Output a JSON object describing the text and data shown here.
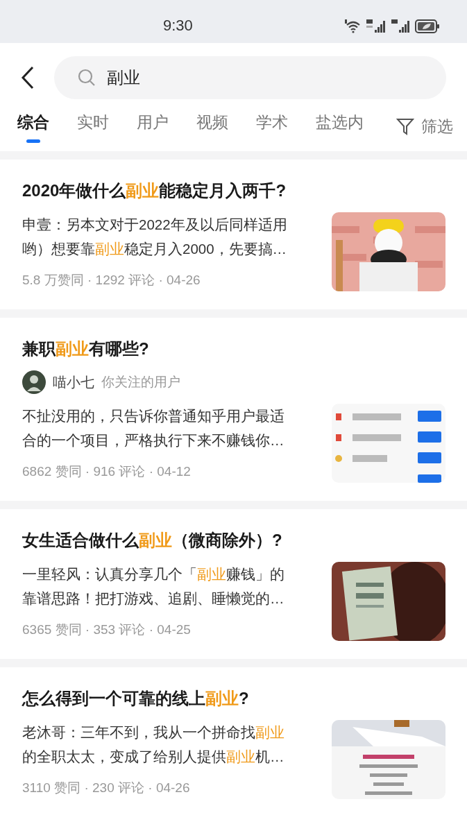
{
  "status_bar": {
    "time": "9:30"
  },
  "search": {
    "value": "副业"
  },
  "tabs": [
    {
      "label": "综合",
      "selected": true
    },
    {
      "label": "实时",
      "selected": false
    },
    {
      "label": "用户",
      "selected": false
    },
    {
      "label": "视频",
      "selected": false
    },
    {
      "label": "学术",
      "selected": false
    },
    {
      "label": "盐选内",
      "selected": false
    }
  ],
  "filter": {
    "label": "筛选"
  },
  "results": [
    {
      "title": [
        {
          "text": "2020年做什么",
          "hl": false
        },
        {
          "text": "副业",
          "hl": true
        },
        {
          "text": "能稳定月入两千?",
          "hl": false
        }
      ],
      "excerpt": [
        [
          {
            "text": "申壹：另本文对于2022年及以后同样适用",
            "hl": false
          }
        ],
        [
          {
            "text": "哟）想要靠",
            "hl": false
          },
          {
            "text": "副业",
            "hl": true
          },
          {
            "text": "稳定月入2000，先要搞…",
            "hl": false
          }
        ]
      ],
      "stats": "5.8 万赞同 · 1292 评论 · 04-26",
      "thumbnail": {
        "kind": "picture"
      }
    },
    {
      "title": [
        {
          "text": "兼职",
          "hl": false
        },
        {
          "text": "副业",
          "hl": true
        },
        {
          "text": "有哪些?",
          "hl": false
        }
      ],
      "author": {
        "name": "喵小七",
        "note": "你关注的用户"
      },
      "excerpt": [
        [
          {
            "text": "不扯没用的，只告诉你普通知乎用户最适",
            "hl": false
          }
        ],
        [
          {
            "text": "合的一个项目，严格执行下来不赚钱你…",
            "hl": false
          }
        ]
      ],
      "stats": "6862 赞同 · 916 评论 · 04-12",
      "thumbnail": {
        "kind": "picture"
      }
    },
    {
      "title": [
        {
          "text": "女生适合做什么",
          "hl": false
        },
        {
          "text": "副业",
          "hl": true
        },
        {
          "text": "（微商除外）?",
          "hl": false
        }
      ],
      "excerpt": [
        [
          {
            "text": "一里轻风：认真分享几个「",
            "hl": false
          },
          {
            "text": "副业",
            "hl": true
          },
          {
            "text": "赚钱」的",
            "hl": false
          }
        ],
        [
          {
            "text": "靠谱思路！把打游戏、追剧、睡懒觉的…",
            "hl": false
          }
        ]
      ],
      "stats": "6365 赞同 · 353 评论 · 04-25",
      "thumbnail": {
        "kind": "picture"
      }
    },
    {
      "title": [
        {
          "text": "怎么得到一个可靠的线上",
          "hl": false
        },
        {
          "text": "副业",
          "hl": true
        },
        {
          "text": "?",
          "hl": false
        }
      ],
      "excerpt": [
        [
          {
            "text": "老沐哥：三年不到，我从一个拼命找",
            "hl": false
          },
          {
            "text": "副业",
            "hl": true
          }
        ],
        [
          {
            "text": "的全职太太，变成了给别人提供",
            "hl": false
          },
          {
            "text": "副业",
            "hl": true
          },
          {
            "text": "机…",
            "hl": false
          }
        ]
      ],
      "stats": "3110 赞同 · 230 评论 · 04-26",
      "thumbnail": {
        "kind": "picture"
      }
    }
  ]
}
